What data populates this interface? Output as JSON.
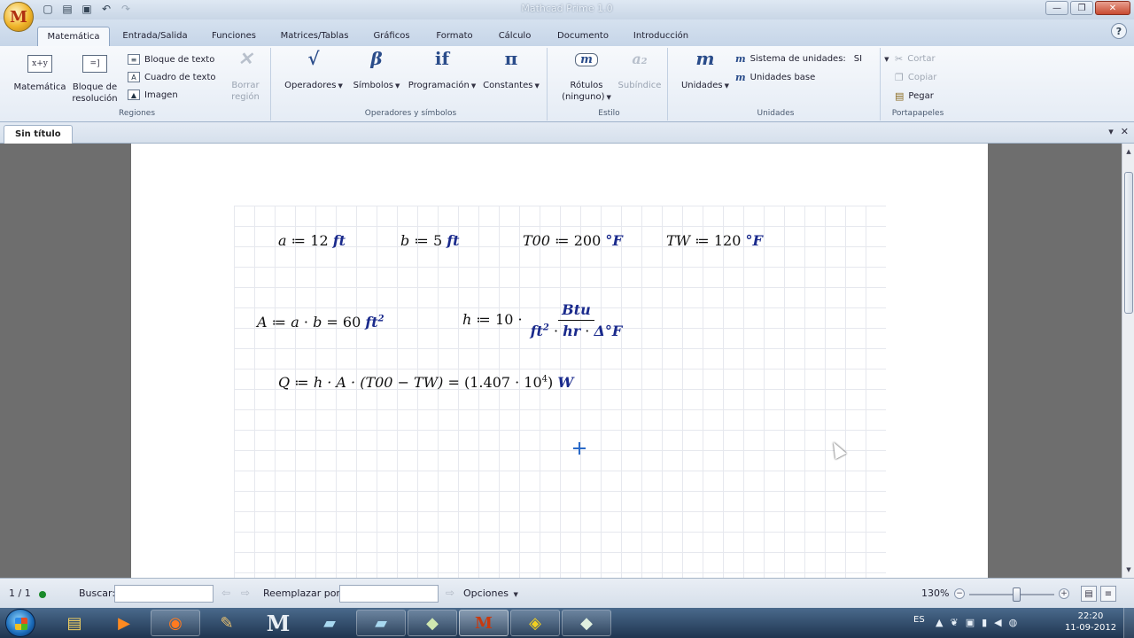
{
  "window": {
    "title": "Mathcad Prime 1.0",
    "controls": {
      "minimize": "—",
      "maximize": "❐",
      "close": "✕"
    }
  },
  "app_icon": "M",
  "qat": {
    "new_icon": "new-document-icon",
    "open_icon": "open-folder-icon",
    "save_icon": "save-icon",
    "undo_icon": "undo-icon",
    "redo_icon": "redo-icon"
  },
  "ribbon_tabs": [
    "Matemática",
    "Entrada/Salida",
    "Funciones",
    "Matrices/Tablas",
    "Gráficos",
    "Formato",
    "Cálculo",
    "Documento",
    "Introducción"
  ],
  "help_label": "?",
  "ribbon": {
    "regiones": {
      "label": "Regiones",
      "matematica": "Matemática",
      "bloque_resolucion_1": "Bloque de",
      "bloque_resolucion_2": "resolución",
      "bloque_texto": "Bloque de texto",
      "cuadro_texto": "Cuadro de texto",
      "imagen": "Imagen",
      "borrar_1": "Borrar",
      "borrar_2": "región"
    },
    "operadores": {
      "label": "Operadores y símbolos",
      "operadores": "Operadores",
      "simbolos": "Símbolos",
      "programacion": "Programación",
      "constantes": "Constantes",
      "sym_operadores": "√",
      "sym_simbolos": "β",
      "sym_programacion": "if",
      "sym_constantes": "π"
    },
    "estilo": {
      "label": "Estilo",
      "rotulos_1": "Rótulos",
      "rotulos_2": "(ninguno)",
      "subindice": "Subíndice",
      "sym_rotulos": "m",
      "sym_subindice": "a₂"
    },
    "unidades": {
      "label": "Unidades",
      "unidades": "Unidades",
      "sym_unidades": "m",
      "sistema": "Sistema de unidades:",
      "sistema_value": "SI",
      "unidades_base": "Unidades base"
    },
    "portapapeles": {
      "label": "Portapapeles",
      "cortar": "Cortar",
      "copiar": "Copiar",
      "pegar": "Pegar"
    }
  },
  "document_tab": "Sin título",
  "worksheet": {
    "eq_a": {
      "lhs": "a",
      "assign": "≔",
      "value": "12",
      "unit": "ft"
    },
    "eq_b": {
      "lhs": "b",
      "assign": "≔",
      "value": "5",
      "unit": "ft"
    },
    "eq_t00": {
      "lhs": "T00",
      "assign": "≔",
      "value": "200",
      "unit": "°F"
    },
    "eq_tw": {
      "lhs": "TW",
      "assign": "≔",
      "value": "120",
      "unit": "°F"
    },
    "eq_area": {
      "lhs": "A",
      "expr_a": "a",
      "expr_b": "b",
      "result": "60",
      "unit": "ft",
      "exp": "2"
    },
    "eq_h": {
      "lhs": "h",
      "coef": "10",
      "num": "Btu",
      "den_ft": "ft",
      "den_exp": "2",
      "den_hr": "hr",
      "den_df": "Δ°F"
    },
    "eq_q": {
      "lhs": "Q",
      "expr": "h · A · (T00 − TW)",
      "result": "(1.407 · 10",
      "exp": "4",
      "close": ")",
      "unit": "W"
    }
  },
  "status": {
    "page": "1 / 1",
    "buscar": "Buscar:",
    "reemplazar": "Reemplazar por:",
    "opciones": "Opciones",
    "zoom": "130%",
    "zoom_level": 0.55
  },
  "taskbar": {
    "apps": [
      "explorer-icon",
      "media-player-icon",
      "firefox-icon",
      "paint-icon",
      "mathcad-m-icon",
      "notepad-icon",
      "documents-icon",
      "autocad-icon",
      "mathcad-prime-icon",
      "matlab-icon",
      "remote-icon"
    ],
    "lang": "ES",
    "time": "22:20",
    "date": "11-09-2012"
  }
}
